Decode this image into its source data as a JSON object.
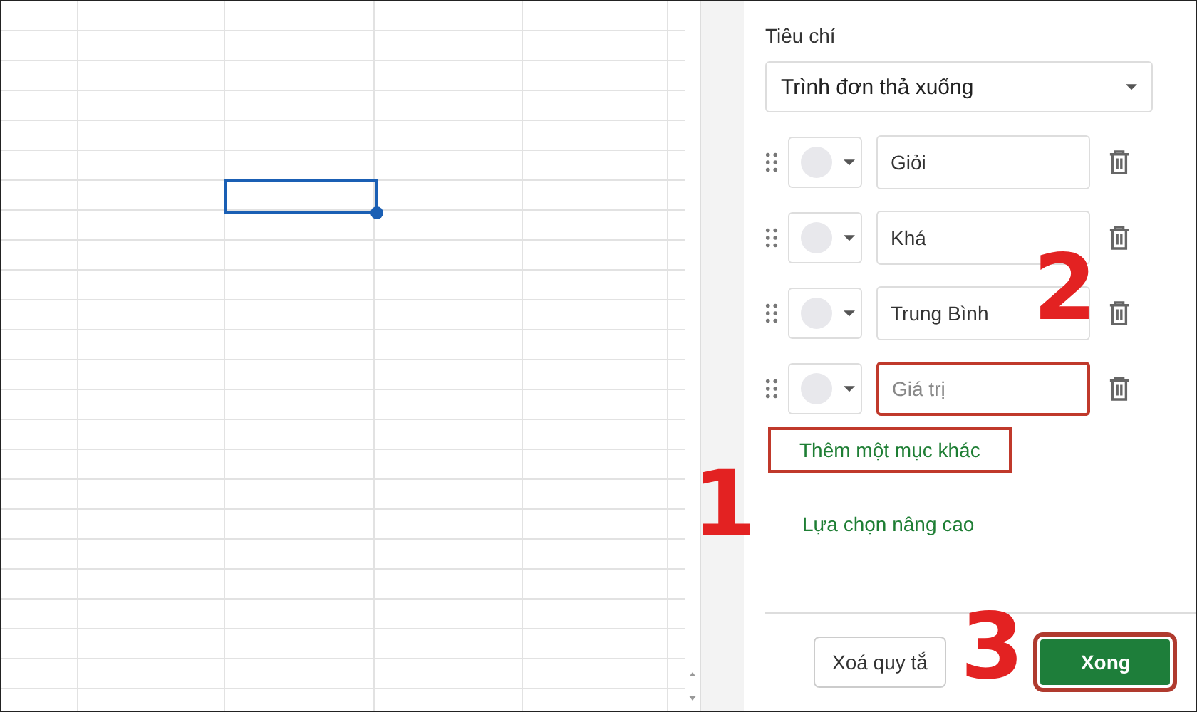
{
  "spreadsheet": {
    "selected_cell": {
      "selected": true
    }
  },
  "panel": {
    "criteria_label": "Tiêu chí",
    "criteria_select": {
      "value": "Trình đơn thả xuống"
    },
    "items": [
      {
        "value": "Giỏi",
        "highlighted": false
      },
      {
        "value": "Khá",
        "highlighted": false
      },
      {
        "value": "Trung Bình",
        "highlighted": false
      },
      {
        "placeholder": "Giá trị",
        "highlighted": true
      }
    ],
    "add_link": {
      "label": "Thêm một mục khác",
      "highlighted": true
    },
    "advanced_link": {
      "label": "Lựa chọn nâng cao"
    },
    "buttons": [
      {
        "label": "Xoá quy tắ",
        "kind": "secondary",
        "highlighted": false
      },
      {
        "label": "Xong",
        "kind": "primary",
        "highlighted": true
      }
    ]
  },
  "annotations": [
    "1",
    "2",
    "3"
  ]
}
